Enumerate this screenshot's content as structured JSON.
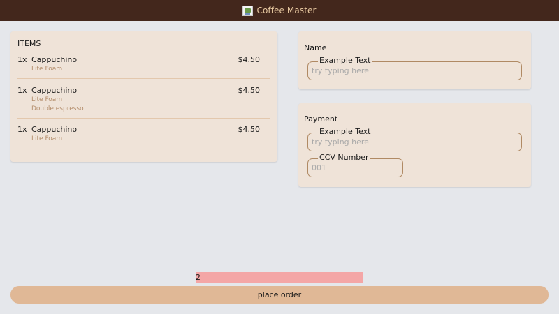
{
  "header": {
    "title": "Coffee Master",
    "logo_icon": "broken-image-icon"
  },
  "order": {
    "heading": "ITEMS",
    "items": [
      {
        "qty": "1x",
        "name": "Cappuchino",
        "price": "$4.50",
        "modifiers": [
          "Lite Foam"
        ]
      },
      {
        "qty": "1x",
        "name": "Cappuchino",
        "price": "$4.50",
        "modifiers": [
          "Lite Foam",
          "Double espresso"
        ]
      },
      {
        "qty": "1x",
        "name": "Cappuchino",
        "price": "$4.50",
        "modifiers": [
          "Lite Foam"
        ]
      }
    ]
  },
  "name_section": {
    "label": "Name",
    "field": {
      "legend": "Example Text",
      "placeholder": "try typing here",
      "value": ""
    }
  },
  "payment_section": {
    "label": "Payment",
    "card_field": {
      "legend": "Example Text",
      "placeholder": "try typing here",
      "value": ""
    },
    "ccv_field": {
      "legend": "CCV Number",
      "placeholder": "001",
      "value": ""
    }
  },
  "footer": {
    "count": "2",
    "place_order_label": "place order"
  },
  "colors": {
    "header_bg": "#43271c",
    "accent": "#e0b896",
    "card_bg": "#efe3d8",
    "count_bg": "#f4a6a6"
  }
}
